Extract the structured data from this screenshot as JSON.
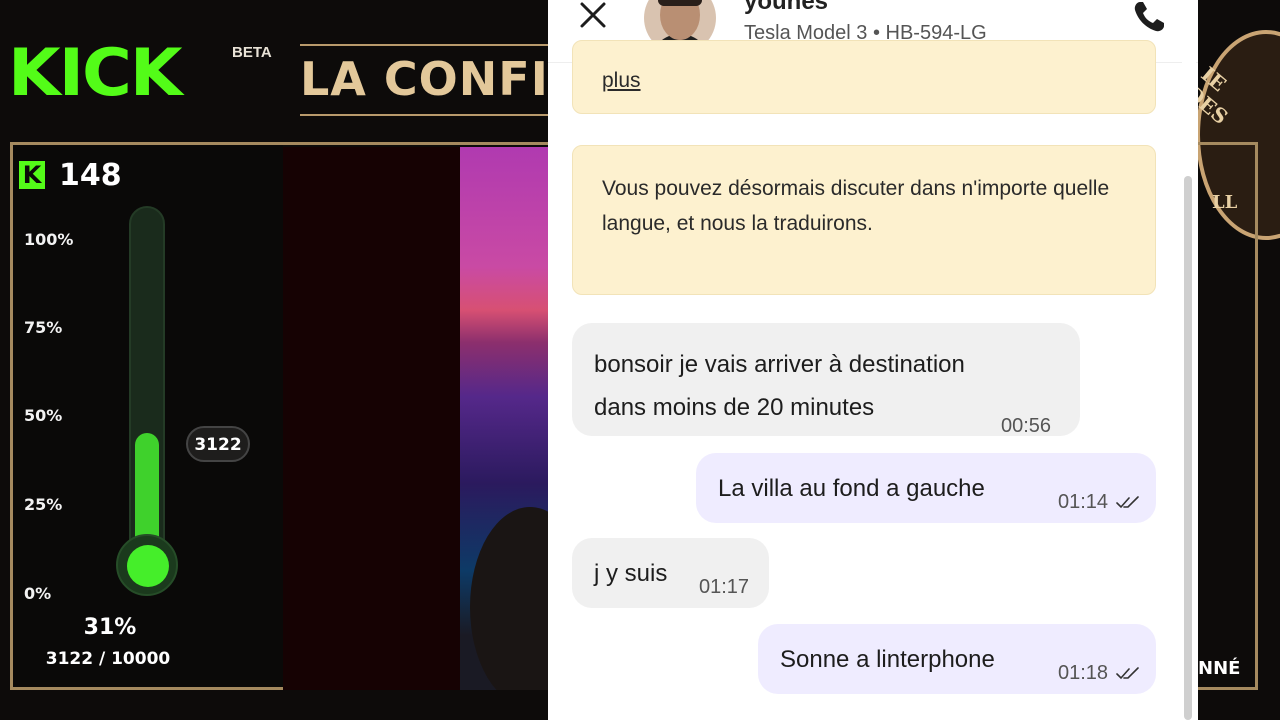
{
  "stream": {
    "logo_text": "KICK",
    "logo_badge": "BETA",
    "banner_text": "LA CONFI",
    "viewer_badge": "K",
    "viewer_count": "148",
    "right_label": "NNÉ",
    "emblem_top_text": "IE DES",
    "emblem_bottom_text": "LL",
    "brand_color": "#53fc18"
  },
  "gauge": {
    "ticks": [
      "100%",
      "75%",
      "50%",
      "25%",
      "0%"
    ],
    "current_value": "3122",
    "percent_label": "31%",
    "ratio_label": "3122 / 10000",
    "fill_fraction": 0.31,
    "fill_color": "#3fd12c"
  },
  "chat": {
    "driver_name": "younes",
    "driver_vehicle": "Tesla Model 3 • HB-594-LG",
    "close_icon": "close-icon",
    "phone_icon": "phone-icon",
    "notice_top_link": "plus",
    "notice_main": "Vous pouvez désormais discuter dans n'importe quelle langue, et nous la traduirons.",
    "messages": [
      {
        "direction": "in",
        "line1": "bonsoir je vais arriver à destination",
        "line2": "dans moins de 20 minutes",
        "time": "00:56"
      },
      {
        "direction": "out",
        "text": "La villa au fond a gauche",
        "time": "01:14",
        "read": true
      },
      {
        "direction": "in",
        "text": "j y suis",
        "time": "01:17"
      },
      {
        "direction": "out",
        "text": "Sonne a linterphone",
        "time": "01:18",
        "read": true
      }
    ],
    "incoming_bubble_color": "#f0f0f0",
    "outgoing_bubble_color": "#efecff",
    "notice_color": "#fdf1cf"
  }
}
